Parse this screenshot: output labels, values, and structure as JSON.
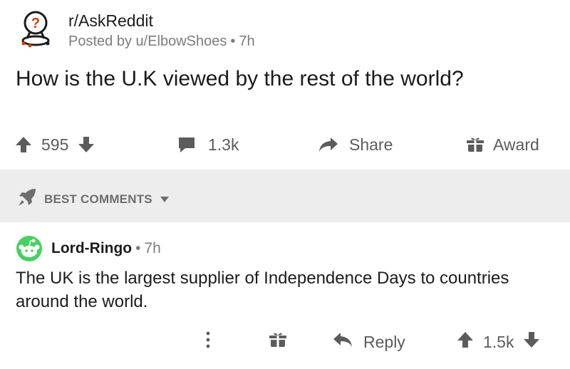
{
  "post": {
    "subreddit": "r/AskReddit",
    "posted_by_prefix": "Posted by",
    "author": "u/ElbowShoes",
    "time": "7h",
    "title": "How is the U.K viewed by the rest of the world?",
    "score": "595",
    "comments": "1.3k",
    "share_label": "Share",
    "award_label": "Award"
  },
  "sort": {
    "label": "BEST COMMENTS"
  },
  "comment": {
    "author": "Lord-Ringo",
    "time": "7h",
    "body": "The UK is the largest supplier of Independence Days to countries around the world.",
    "reply_label": "Reply",
    "score": "1.5k"
  },
  "colors": {
    "text": "#1c1c1c",
    "meta": "#7c7c7c",
    "icon": "#5c5c5c",
    "band": "#ededed",
    "avatar_green": "#46d160"
  },
  "icons": [
    "subreddit-avatar-icon",
    "upvote-icon",
    "downvote-icon",
    "comment-icon",
    "share-icon",
    "award-icon",
    "rocket-icon",
    "caret-down-icon",
    "more-icon",
    "reply-icon"
  ]
}
